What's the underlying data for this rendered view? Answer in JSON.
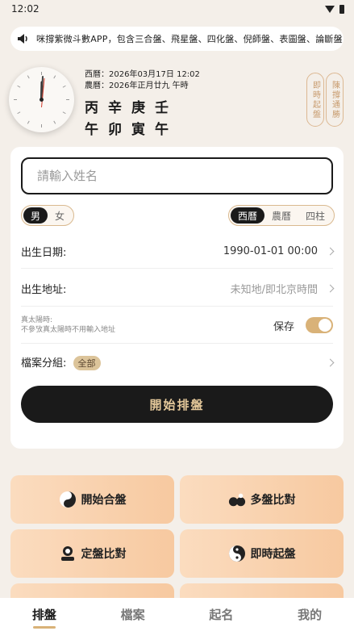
{
  "status_bar": {
    "time": "12:02"
  },
  "marquee": {
    "text": "咪撐紫微斗數APP，包含三合盤、飛星盤、四化盤、倪師盤、表圖盤、論斷盤"
  },
  "clock": {
    "hour": 12,
    "minute": 2
  },
  "dates": {
    "solar": "西曆：2026年03月17日 12:02",
    "lunar": "農曆：2026年正月廿九 午時"
  },
  "ganzhi": {
    "stems": [
      "丙",
      "辛",
      "庚",
      "壬"
    ],
    "branches": [
      "午",
      "卯",
      "寅",
      "午"
    ]
  },
  "side_buttons": {
    "instant": "即時起盤",
    "tutorial": "陳撐通勝"
  },
  "form": {
    "name_placeholder": "請輸入姓名",
    "gender": {
      "male": "男",
      "female": "女",
      "selected": "男"
    },
    "calendar": {
      "solar": "西曆",
      "lunar": "農曆",
      "pillars": "四柱",
      "selected": "西曆"
    },
    "birth_date": {
      "label": "出生日期:",
      "value": "1990-01-01 00:00"
    },
    "birth_place": {
      "label": "出生地址:",
      "value": "未知地/即北京時間"
    },
    "true_solar": {
      "label": "真太陽時:",
      "note": "不參攷真太陽時不用輸入地址",
      "save_label": "保存",
      "save_enabled": true
    },
    "group": {
      "label": "檔案分組:",
      "badge": "全部"
    },
    "start_label": "開始排盤"
  },
  "features": [
    {
      "label": "開始合盤",
      "icon": "taiji-icon"
    },
    {
      "label": "多盤比對",
      "icon": "duo-icon"
    },
    {
      "label": "定盤比對",
      "icon": "person-icon"
    },
    {
      "label": "即時起盤",
      "icon": "yinyang-icon"
    }
  ],
  "tabs": [
    {
      "label": "排盤",
      "active": true
    },
    {
      "label": "檔案",
      "active": false
    },
    {
      "label": "起名",
      "active": false
    },
    {
      "label": "我的",
      "active": false
    }
  ],
  "colors": {
    "accent": "#d9b278",
    "dark": "#1a1a1a",
    "feature_bg": "#f7c9a0"
  }
}
